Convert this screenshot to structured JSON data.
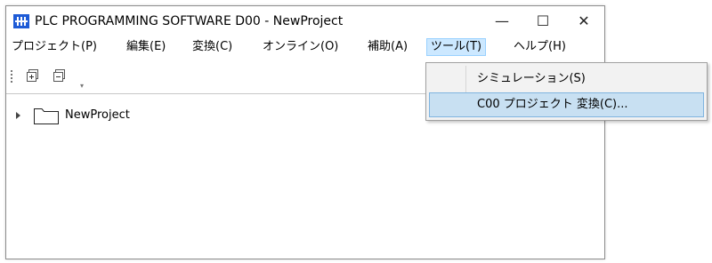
{
  "window": {
    "title": "PLC PROGRAMMING SOFTWARE D00  - NewProject",
    "app_icon_text": "▮▮",
    "minimize_glyph": "—",
    "maximize_glyph": "☐",
    "close_glyph": "✕"
  },
  "menubar": {
    "items": [
      {
        "label": "プロジェクト(P)"
      },
      {
        "label": "編集(E)"
      },
      {
        "label": "変換(C)"
      },
      {
        "label": "オンライン(O)"
      },
      {
        "label": "補助(A)"
      },
      {
        "label": "ツール(T)"
      },
      {
        "label": "ヘルプ(H)"
      }
    ],
    "active_index": 5
  },
  "toolbar": {
    "buttons": [
      "expand-all-icon",
      "collapse-all-icon"
    ],
    "overflow_glyph": "▾"
  },
  "tree": {
    "root": {
      "label": "NewProject",
      "icon": "folder-icon",
      "expanded": false
    }
  },
  "dropdown": {
    "items": [
      {
        "label": "シミュレーション(S)",
        "highlighted": false
      },
      {
        "label": "C00 プロジェクト 変換(C)...",
        "highlighted": true
      }
    ]
  },
  "colors": {
    "app_icon": "#1e5bd6",
    "menu_active_bg": "#cce8ff",
    "dropdown_highlight_bg": "#c8e0f2"
  }
}
